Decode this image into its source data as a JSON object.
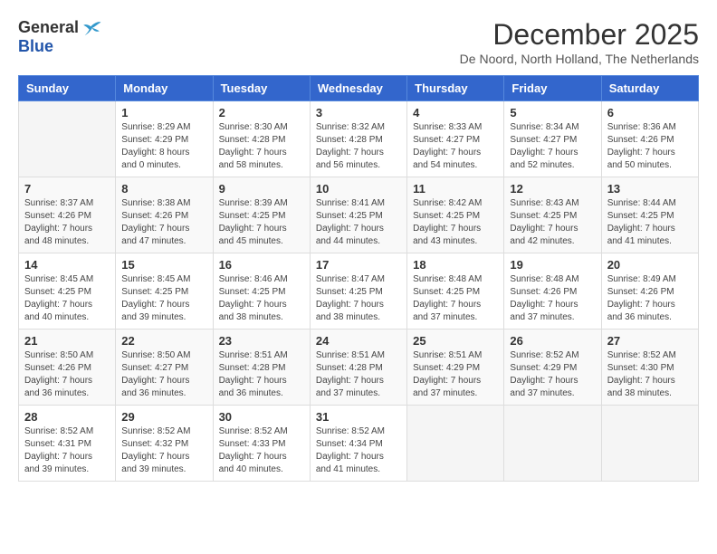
{
  "logo": {
    "general": "General",
    "blue": "Blue"
  },
  "header": {
    "title": "December 2025",
    "subtitle": "De Noord, North Holland, The Netherlands"
  },
  "weekdays": [
    "Sunday",
    "Monday",
    "Tuesday",
    "Wednesday",
    "Thursday",
    "Friday",
    "Saturday"
  ],
  "weeks": [
    [
      {
        "day": "",
        "empty": true
      },
      {
        "day": "1",
        "sunrise": "Sunrise: 8:29 AM",
        "sunset": "Sunset: 4:29 PM",
        "daylight": "Daylight: 8 hours and 0 minutes."
      },
      {
        "day": "2",
        "sunrise": "Sunrise: 8:30 AM",
        "sunset": "Sunset: 4:28 PM",
        "daylight": "Daylight: 7 hours and 58 minutes."
      },
      {
        "day": "3",
        "sunrise": "Sunrise: 8:32 AM",
        "sunset": "Sunset: 4:28 PM",
        "daylight": "Daylight: 7 hours and 56 minutes."
      },
      {
        "day": "4",
        "sunrise": "Sunrise: 8:33 AM",
        "sunset": "Sunset: 4:27 PM",
        "daylight": "Daylight: 7 hours and 54 minutes."
      },
      {
        "day": "5",
        "sunrise": "Sunrise: 8:34 AM",
        "sunset": "Sunset: 4:27 PM",
        "daylight": "Daylight: 7 hours and 52 minutes."
      },
      {
        "day": "6",
        "sunrise": "Sunrise: 8:36 AM",
        "sunset": "Sunset: 4:26 PM",
        "daylight": "Daylight: 7 hours and 50 minutes."
      }
    ],
    [
      {
        "day": "7",
        "sunrise": "Sunrise: 8:37 AM",
        "sunset": "Sunset: 4:26 PM",
        "daylight": "Daylight: 7 hours and 48 minutes."
      },
      {
        "day": "8",
        "sunrise": "Sunrise: 8:38 AM",
        "sunset": "Sunset: 4:26 PM",
        "daylight": "Daylight: 7 hours and 47 minutes."
      },
      {
        "day": "9",
        "sunrise": "Sunrise: 8:39 AM",
        "sunset": "Sunset: 4:25 PM",
        "daylight": "Daylight: 7 hours and 45 minutes."
      },
      {
        "day": "10",
        "sunrise": "Sunrise: 8:41 AM",
        "sunset": "Sunset: 4:25 PM",
        "daylight": "Daylight: 7 hours and 44 minutes."
      },
      {
        "day": "11",
        "sunrise": "Sunrise: 8:42 AM",
        "sunset": "Sunset: 4:25 PM",
        "daylight": "Daylight: 7 hours and 43 minutes."
      },
      {
        "day": "12",
        "sunrise": "Sunrise: 8:43 AM",
        "sunset": "Sunset: 4:25 PM",
        "daylight": "Daylight: 7 hours and 42 minutes."
      },
      {
        "day": "13",
        "sunrise": "Sunrise: 8:44 AM",
        "sunset": "Sunset: 4:25 PM",
        "daylight": "Daylight: 7 hours and 41 minutes."
      }
    ],
    [
      {
        "day": "14",
        "sunrise": "Sunrise: 8:45 AM",
        "sunset": "Sunset: 4:25 PM",
        "daylight": "Daylight: 7 hours and 40 minutes."
      },
      {
        "day": "15",
        "sunrise": "Sunrise: 8:45 AM",
        "sunset": "Sunset: 4:25 PM",
        "daylight": "Daylight: 7 hours and 39 minutes."
      },
      {
        "day": "16",
        "sunrise": "Sunrise: 8:46 AM",
        "sunset": "Sunset: 4:25 PM",
        "daylight": "Daylight: 7 hours and 38 minutes."
      },
      {
        "day": "17",
        "sunrise": "Sunrise: 8:47 AM",
        "sunset": "Sunset: 4:25 PM",
        "daylight": "Daylight: 7 hours and 38 minutes."
      },
      {
        "day": "18",
        "sunrise": "Sunrise: 8:48 AM",
        "sunset": "Sunset: 4:25 PM",
        "daylight": "Daylight: 7 hours and 37 minutes."
      },
      {
        "day": "19",
        "sunrise": "Sunrise: 8:48 AM",
        "sunset": "Sunset: 4:26 PM",
        "daylight": "Daylight: 7 hours and 37 minutes."
      },
      {
        "day": "20",
        "sunrise": "Sunrise: 8:49 AM",
        "sunset": "Sunset: 4:26 PM",
        "daylight": "Daylight: 7 hours and 36 minutes."
      }
    ],
    [
      {
        "day": "21",
        "sunrise": "Sunrise: 8:50 AM",
        "sunset": "Sunset: 4:26 PM",
        "daylight": "Daylight: 7 hours and 36 minutes."
      },
      {
        "day": "22",
        "sunrise": "Sunrise: 8:50 AM",
        "sunset": "Sunset: 4:27 PM",
        "daylight": "Daylight: 7 hours and 36 minutes."
      },
      {
        "day": "23",
        "sunrise": "Sunrise: 8:51 AM",
        "sunset": "Sunset: 4:28 PM",
        "daylight": "Daylight: 7 hours and 36 minutes."
      },
      {
        "day": "24",
        "sunrise": "Sunrise: 8:51 AM",
        "sunset": "Sunset: 4:28 PM",
        "daylight": "Daylight: 7 hours and 37 minutes."
      },
      {
        "day": "25",
        "sunrise": "Sunrise: 8:51 AM",
        "sunset": "Sunset: 4:29 PM",
        "daylight": "Daylight: 7 hours and 37 minutes."
      },
      {
        "day": "26",
        "sunrise": "Sunrise: 8:52 AM",
        "sunset": "Sunset: 4:29 PM",
        "daylight": "Daylight: 7 hours and 37 minutes."
      },
      {
        "day": "27",
        "sunrise": "Sunrise: 8:52 AM",
        "sunset": "Sunset: 4:30 PM",
        "daylight": "Daylight: 7 hours and 38 minutes."
      }
    ],
    [
      {
        "day": "28",
        "sunrise": "Sunrise: 8:52 AM",
        "sunset": "Sunset: 4:31 PM",
        "daylight": "Daylight: 7 hours and 39 minutes."
      },
      {
        "day": "29",
        "sunrise": "Sunrise: 8:52 AM",
        "sunset": "Sunset: 4:32 PM",
        "daylight": "Daylight: 7 hours and 39 minutes."
      },
      {
        "day": "30",
        "sunrise": "Sunrise: 8:52 AM",
        "sunset": "Sunset: 4:33 PM",
        "daylight": "Daylight: 7 hours and 40 minutes."
      },
      {
        "day": "31",
        "sunrise": "Sunrise: 8:52 AM",
        "sunset": "Sunset: 4:34 PM",
        "daylight": "Daylight: 7 hours and 41 minutes."
      },
      {
        "day": "",
        "empty": true
      },
      {
        "day": "",
        "empty": true
      },
      {
        "day": "",
        "empty": true
      }
    ]
  ]
}
